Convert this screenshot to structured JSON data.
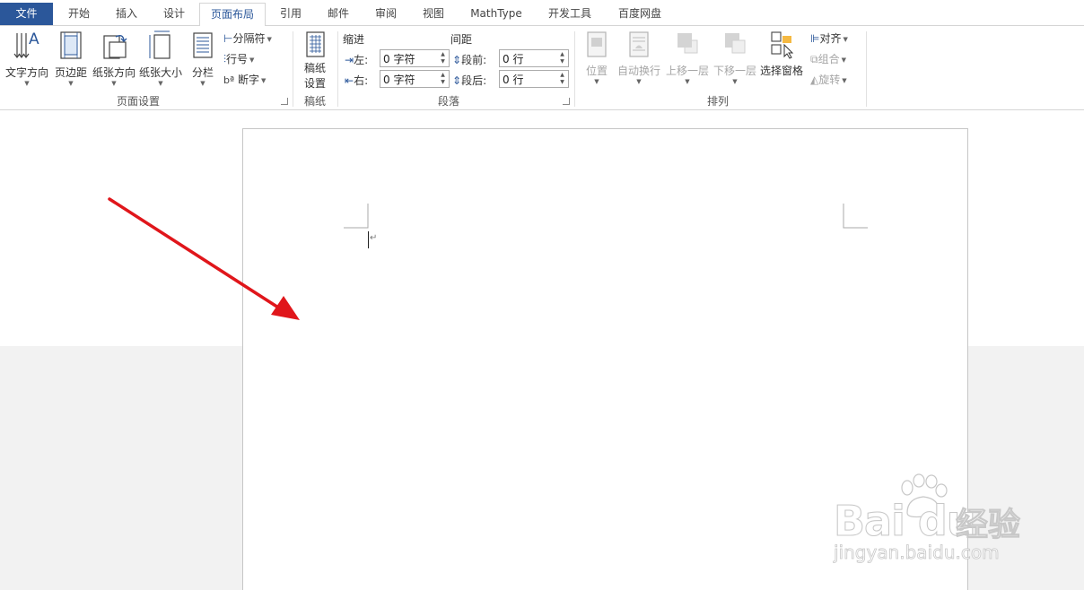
{
  "tabs": [
    {
      "id": "file",
      "label": "文件"
    },
    {
      "id": "home",
      "label": "开始"
    },
    {
      "id": "insert",
      "label": "插入"
    },
    {
      "id": "design",
      "label": "设计"
    },
    {
      "id": "layout",
      "label": "页面布局"
    },
    {
      "id": "references",
      "label": "引用"
    },
    {
      "id": "mailings",
      "label": "邮件"
    },
    {
      "id": "review",
      "label": "审阅"
    },
    {
      "id": "view",
      "label": "视图"
    },
    {
      "id": "mathtype",
      "label": "MathType"
    },
    {
      "id": "developer",
      "label": "开发工具"
    },
    {
      "id": "baidupan",
      "label": "百度网盘"
    }
  ],
  "ribbon": {
    "page_setup": {
      "label": "页面设置",
      "text_direction": "文字方向",
      "margins": "页边距",
      "orientation": "纸张方向",
      "size": "纸张大小",
      "columns": "分栏",
      "breaks": "分隔符",
      "line_numbers": "行号",
      "hyphenation": "断字"
    },
    "manuscript": {
      "label": "稿纸",
      "settings_line1": "稿纸",
      "settings_line2": "设置"
    },
    "paragraph": {
      "label": "段落",
      "indent_heading": "缩进",
      "spacing_heading": "间距",
      "left_label": "左:",
      "right_label": "右:",
      "before_label": "段前:",
      "after_label": "段后:",
      "left_value": "0 字符",
      "right_value": "0 字符",
      "before_value": "0 行",
      "after_value": "0 行"
    },
    "arrange": {
      "label": "排列",
      "position": "位置",
      "wrap_text": "自动换行",
      "bring_forward": "上移一层",
      "send_backward": "下移一层",
      "selection_pane": "选择窗格",
      "align": "对齐",
      "group": "组合",
      "rotate": "旋转"
    }
  },
  "document": {
    "paragraph_mark": "↵"
  },
  "watermark": {
    "logo_text": "Bai du",
    "jingyan": "经验",
    "url": "jingyan.baidu.com"
  },
  "colors": {
    "accent": "#2b579a",
    "arrow": "#e0161b",
    "grey_background": "#f2f2f2"
  }
}
